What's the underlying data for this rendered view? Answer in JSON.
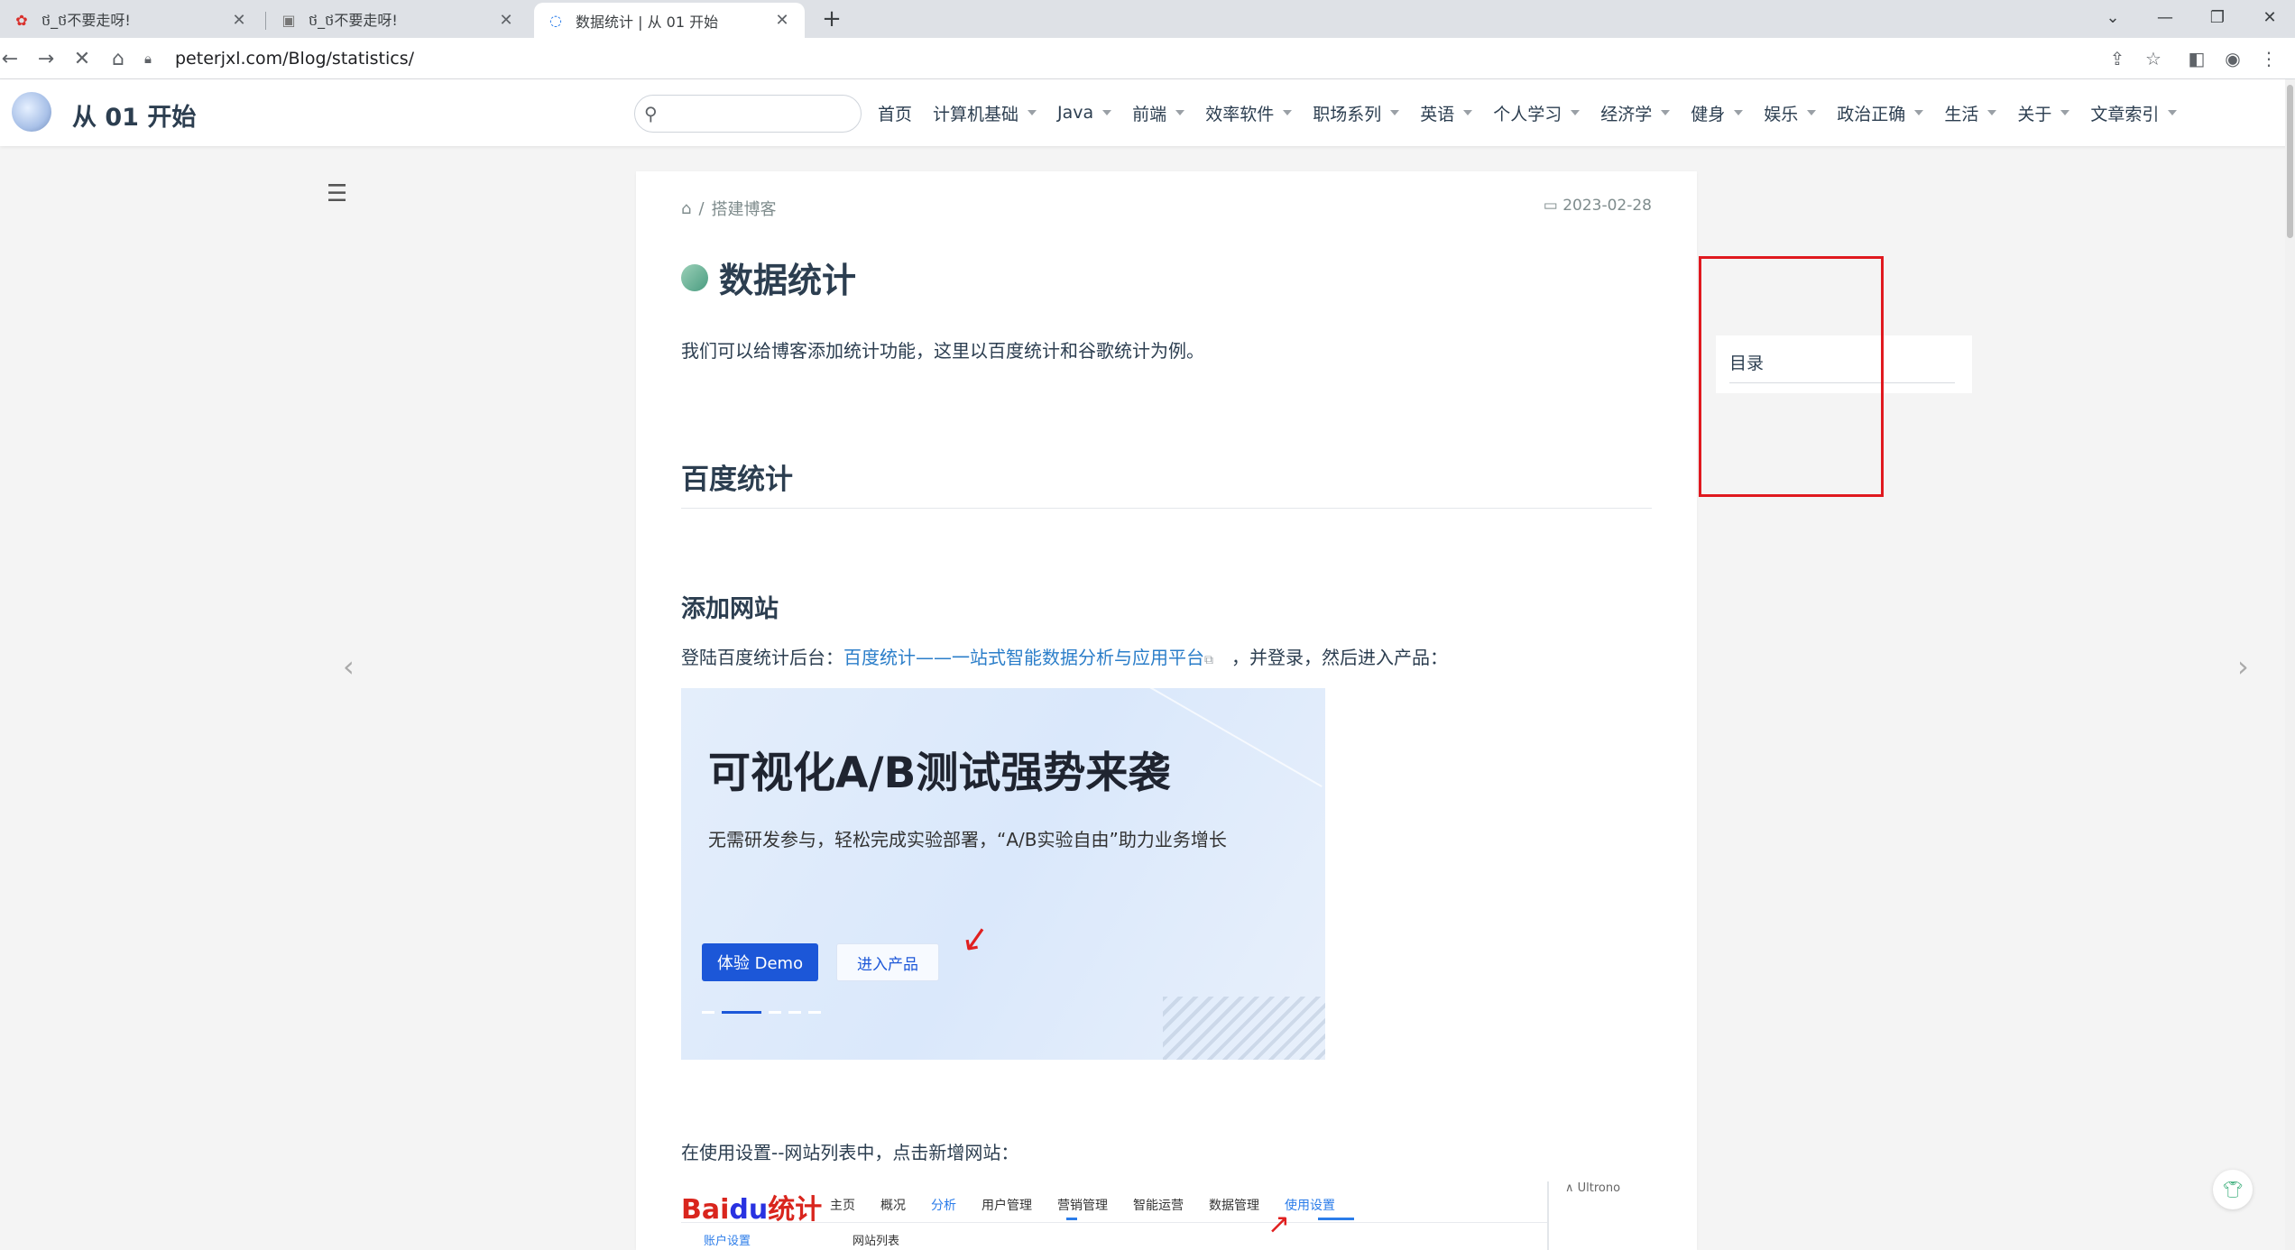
{
  "browser": {
    "tabs": [
      {
        "title": "ថ_ថ不要走呀!",
        "icon": "flower-icon"
      },
      {
        "title": "ថ_ថ不要走呀!",
        "icon": "image-icon"
      },
      {
        "title": "数据统计 | 从 01 开始",
        "icon": "loading-icon"
      }
    ],
    "new_tab": "+",
    "url": "peterjxl.com/Blog/statistics/"
  },
  "site": {
    "name": "从 01 开始",
    "search_placeholder": "",
    "nav": [
      {
        "label": "首页",
        "dropdown": false
      },
      {
        "label": "计算机基础",
        "dropdown": true
      },
      {
        "label": "Java",
        "dropdown": true
      },
      {
        "label": "前端",
        "dropdown": true
      },
      {
        "label": "效率软件",
        "dropdown": true
      },
      {
        "label": "职场系列",
        "dropdown": true
      },
      {
        "label": "英语",
        "dropdown": true
      },
      {
        "label": "个人学习",
        "dropdown": true
      },
      {
        "label": "经济学",
        "dropdown": true
      },
      {
        "label": "健身",
        "dropdown": true
      },
      {
        "label": "娱乐",
        "dropdown": true
      },
      {
        "label": "政治正确",
        "dropdown": true
      },
      {
        "label": "生活",
        "dropdown": true
      },
      {
        "label": "关于",
        "dropdown": true
      },
      {
        "label": "文章索引",
        "dropdown": true
      }
    ]
  },
  "article": {
    "breadcrumb_sep": "/",
    "breadcrumb": "搭建博客",
    "date": "2023-02-28",
    "title": "数据统计",
    "intro": "我们可以给博客添加统计功能，这里以百度统计和谷歌统计为例。",
    "h2": "百度统计",
    "h3": "添加网站",
    "p1_prefix": "登陆百度统计后台：",
    "p1_link": "百度统计——一站式智能数据分析与应用平台",
    "p1_suffix": "，并登录，然后进入产品：",
    "banner": {
      "headline": "可视化A/B测试强势来袭",
      "subline": "无需研发参与，轻松完成实验部署，“A/B实验自由”助力业务增长",
      "btn_demo": "体验 Demo",
      "btn_enter": "进入产品"
    },
    "p2": "在使用设置--网站列表中，点击新增网站：",
    "baidu_shot": {
      "logo_red": "Bai",
      "logo_blue": "du",
      "logo_text": "统计",
      "menu": [
        "主页",
        "概况",
        "分析",
        "用户管理",
        "营销管理",
        "智能运营",
        "数据管理",
        "使用设置"
      ],
      "user": "∧ Ultrono",
      "sub1": "账户设置",
      "sub2": "网站列表"
    }
  },
  "toc": {
    "title": "目录"
  },
  "colors": {
    "accent": "#2b7ec9",
    "highlight_box": "#e0191f",
    "demo_button": "#1c57d8"
  }
}
